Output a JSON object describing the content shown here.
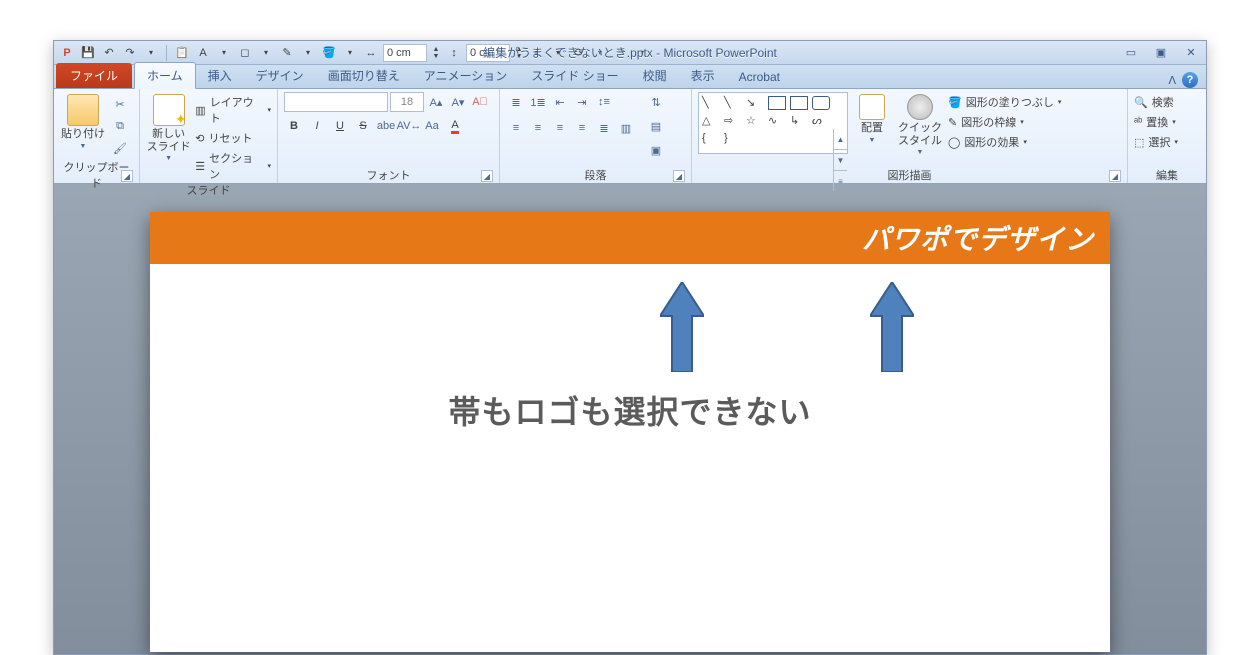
{
  "window": {
    "title": "編集がうまくできないとき.pptx - Microsoft PowerPoint"
  },
  "qat": {
    "dim_w": "0 cm",
    "dim_h": "0 cm"
  },
  "tabs": {
    "file": "ファイル",
    "home": "ホーム",
    "insert": "挿入",
    "design": "デザイン",
    "transitions": "画面切り替え",
    "animations": "アニメーション",
    "slideshow": "スライド ショー",
    "review": "校閲",
    "view": "表示",
    "acrobat": "Acrobat"
  },
  "ribbon": {
    "clipboard": {
      "label": "クリップボード",
      "paste": "貼り付け"
    },
    "slides": {
      "label": "スライド",
      "new": "新しい\nスライド",
      "layout": "レイアウト",
      "reset": "リセット",
      "section": "セクション"
    },
    "font": {
      "label": "フォント",
      "size": "18"
    },
    "paragraph": {
      "label": "段落"
    },
    "drawing": {
      "label": "図形描画",
      "arrange": "配置",
      "quick": "クイック\nスタイル",
      "fill": "図形の塗りつぶし",
      "outline": "図形の枠線",
      "effects": "図形の効果"
    },
    "editing": {
      "label": "編集",
      "find": "検索",
      "replace": "置換",
      "select": "選択"
    }
  },
  "slide": {
    "band_text": "パワポでデザイン",
    "caption": "帯もロゴも選択できない"
  },
  "colors": {
    "band": "#e67817",
    "arrow": "#4f81bd",
    "arrow_border": "#385d8a"
  }
}
